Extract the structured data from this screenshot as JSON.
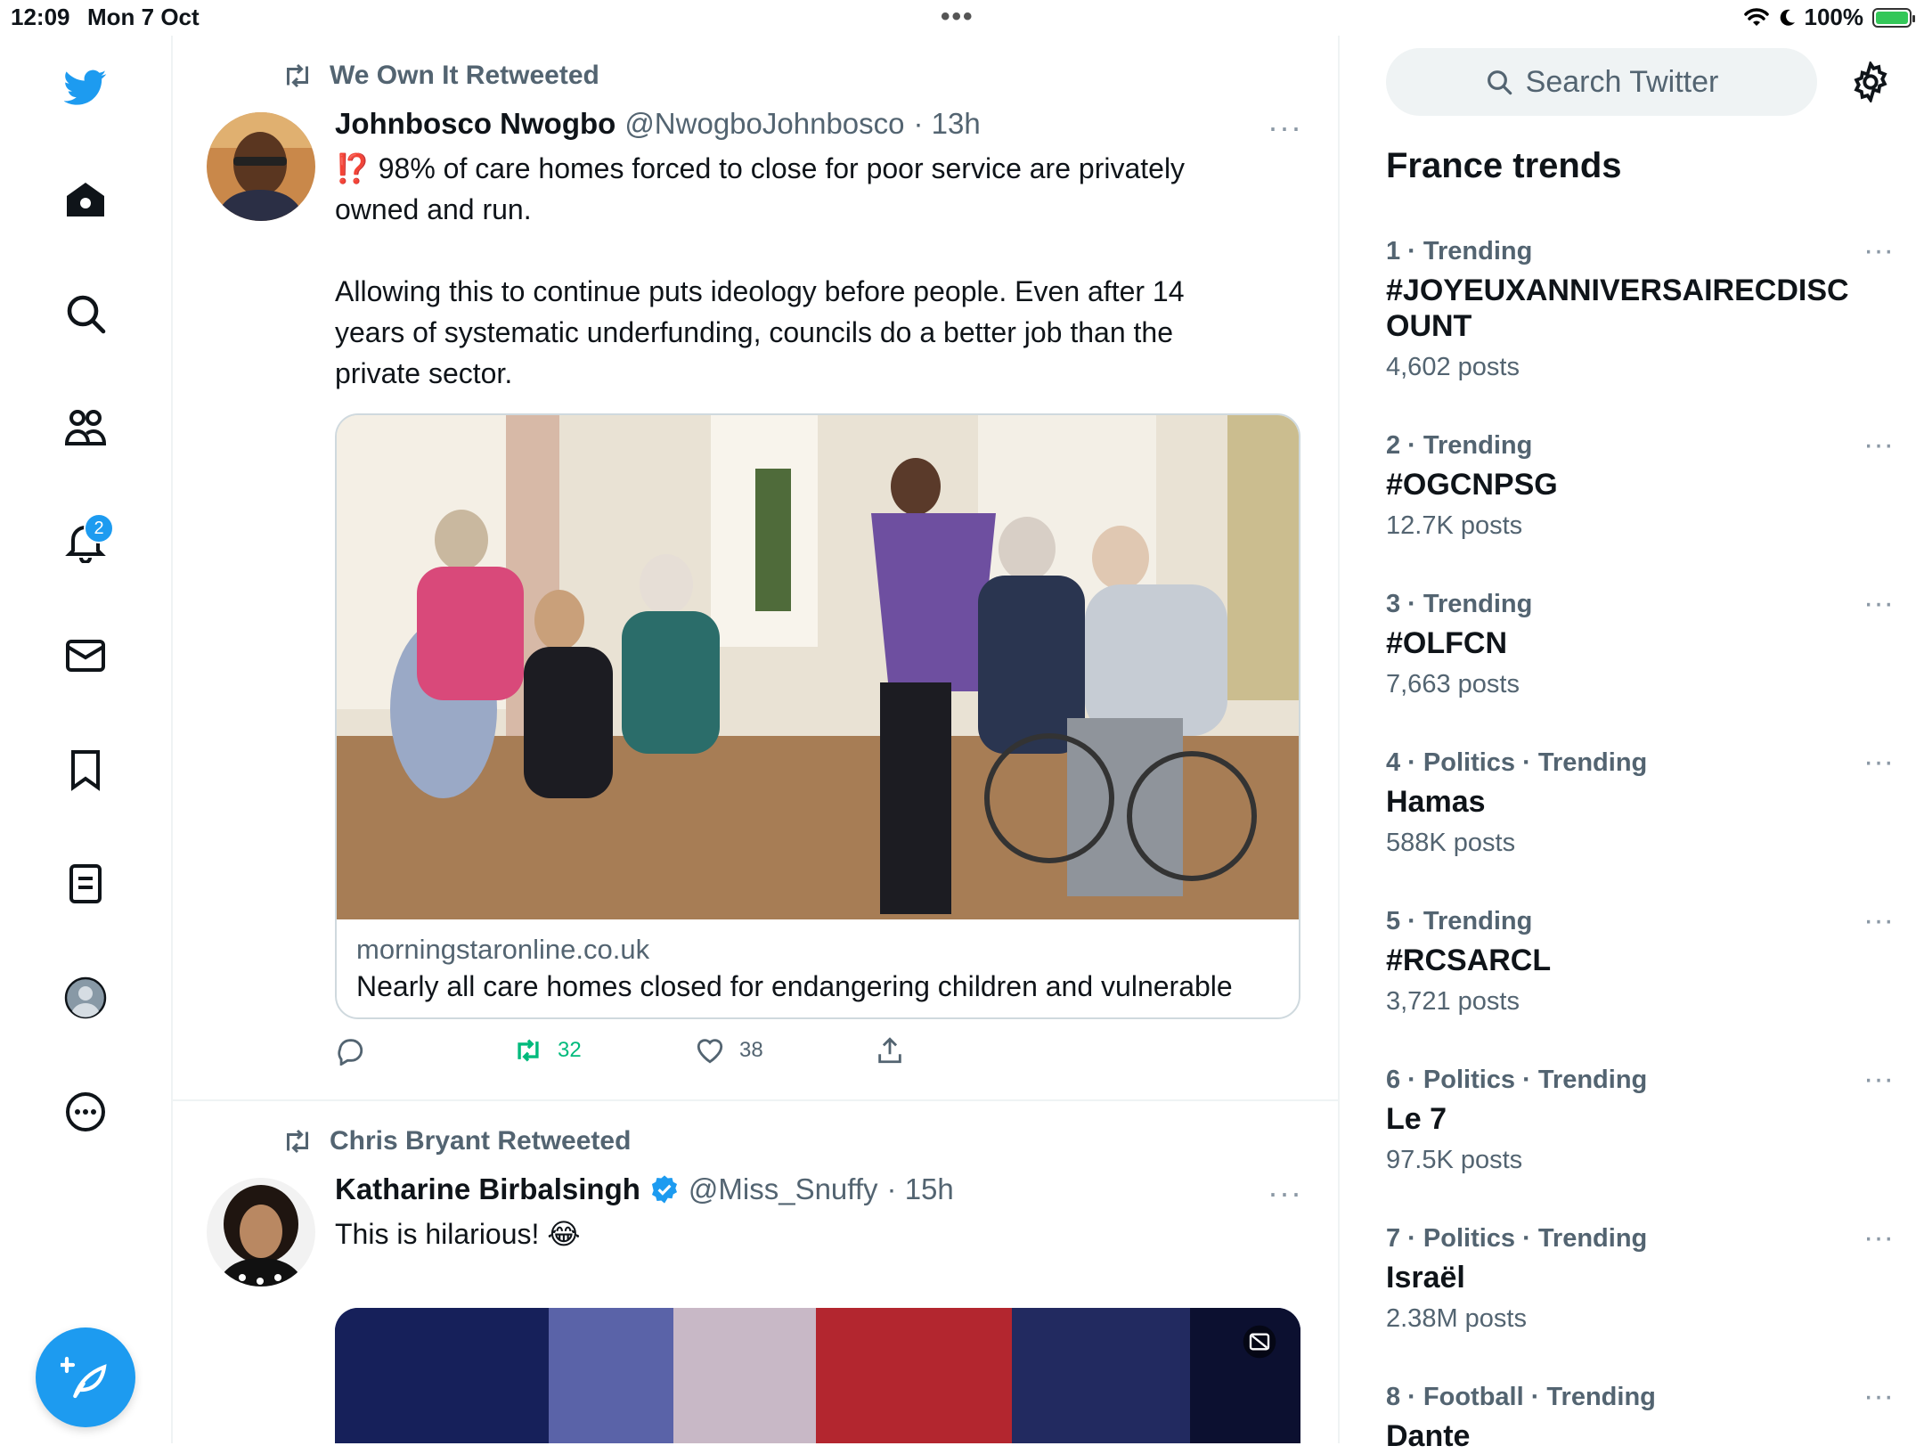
{
  "status_bar": {
    "time": "12:09",
    "date": "Mon 7 Oct",
    "battery": "100%",
    "battery_level": 1.0
  },
  "nav": {
    "items": [
      "twitter-logo",
      "home",
      "explore",
      "communities",
      "notifications",
      "messages",
      "bookmarks",
      "lists",
      "profile",
      "more"
    ],
    "notifications_badge": "2"
  },
  "feed": {
    "tweets": [
      {
        "retweeted_by": "We Own It Retweeted",
        "name": "Johnbosco Nwogbo",
        "handle": "@NwogboJohnbosco",
        "time": "· 13h",
        "more": "···",
        "text_line1": "⁉️ 98% of care homes forced to close for poor service are privately",
        "text_line2": "owned and run.",
        "text_line3": "Allowing this to continue puts ideology before people. Even after 14",
        "text_line4": "years of systematic underfunding, councils do a better job than the",
        "text_line5": "private sector.",
        "card": {
          "domain": "morningstaronline.co.uk",
          "title": "Nearly all care homes closed for endangering children and vulnerable"
        },
        "actions": {
          "replies": "",
          "retweets": "32",
          "likes": "38"
        }
      },
      {
        "retweeted_by": "Chris Bryant Retweeted",
        "name": "Katharine Birbalsingh",
        "handle": "@Miss_Snuffy",
        "time": "· 15h",
        "more": "···",
        "text_line1": "This is hilarious! 😂"
      }
    ]
  },
  "right": {
    "search_placeholder": "Search Twitter",
    "trends_title": "France trends",
    "trends": [
      {
        "meta": "1 · Trending",
        "name": "#JOYEUXANNIVERSAIRECDISCOUNT",
        "posts": "4,602 posts"
      },
      {
        "meta": "2 · Trending",
        "name": "#OGCNPSG",
        "posts": "12.7K posts"
      },
      {
        "meta": "3 · Trending",
        "name": "#OLFCN",
        "posts": "7,663 posts"
      },
      {
        "meta": "4 · Politics · Trending",
        "name": "Hamas",
        "posts": "588K posts"
      },
      {
        "meta": "5 · Trending",
        "name": "#RCSARCL",
        "posts": "3,721 posts"
      },
      {
        "meta": "6 · Politics · Trending",
        "name": "Le 7",
        "posts": "97.5K posts"
      },
      {
        "meta": "7 · Politics · Trending",
        "name": "Israël",
        "posts": "2.38M posts"
      },
      {
        "meta": "8 · Football · Trending",
        "name": "Dante",
        "posts": ""
      }
    ],
    "more": "···"
  },
  "colors": {
    "accent": "#1d9bf0",
    "retweet_green": "#00ba7c",
    "secondary_text": "#536471"
  }
}
